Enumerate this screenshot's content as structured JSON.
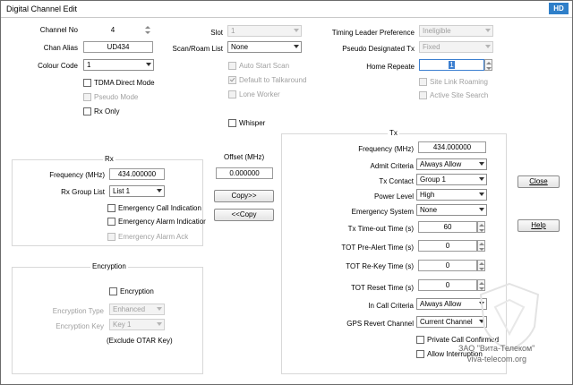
{
  "window": {
    "title": "Digital Channel Edit",
    "badge": "HD"
  },
  "general": {
    "channel_no_label": "Channel No",
    "channel_no_value": "4",
    "chan_alias_label": "Chan Alias",
    "chan_alias_value": "UD434",
    "colour_code_label": "Colour Code",
    "colour_code_value": "1",
    "tdma_direct_label": "TDMA Direct Mode",
    "pseudo_mode_label": "Pseudo Mode",
    "rx_only_label": "Rx Only"
  },
  "slot": {
    "slot_label": "Slot",
    "slot_value": "1",
    "scan_roam_label": "Scan/Roam List",
    "scan_roam_value": "None",
    "auto_start_scan_label": "Auto Start Scan",
    "default_talkaround_label": "Default to Talkaround",
    "lone_worker_label": "Lone Worker",
    "whisper_label": "Whisper"
  },
  "timing": {
    "leader_pref_label": "Timing Leader Preference",
    "leader_pref_value": "Ineligible",
    "pseudo_tx_label": "Pseudo Designated Tx",
    "pseudo_tx_value": "Fixed",
    "home_repeater_label": "Home Repeate",
    "home_repeater_value": "1",
    "site_link_roaming_label": "Site Link Roaming",
    "active_site_search_label": "Active Site Search"
  },
  "rx": {
    "title": "Rx",
    "frequency_label": "Frequency (MHz)",
    "frequency_value": "434.000000",
    "group_list_label": "Rx Group List",
    "group_list_value": "List 1",
    "emergency_call_label": "Emergency Call Indication",
    "emergency_alarm_label": "Emergency Alarm Indicatior",
    "emergency_alarm_ack_label": "Emergency Alarm Ack"
  },
  "offset": {
    "label": "Offset (MHz)",
    "value": "0.000000",
    "copy_to_tx": "Copy>>",
    "copy_to_rx": "<<Copy"
  },
  "encryption": {
    "title": "Encryption",
    "checkbox_label": "Encryption",
    "type_label": "Encryption Type",
    "type_value": "Enhanced",
    "key_label": "Encryption Key",
    "key_value": "Key 1",
    "note": "(Exclude OTAR Key)"
  },
  "tx": {
    "title": "Tx",
    "frequency_label": "Frequency (MHz)",
    "frequency_value": "434.000000",
    "admit_label": "Admit Criteria",
    "admit_value": "Always Allow",
    "contact_label": "Tx Contact",
    "contact_value": "Group 1",
    "power_label": "Power Level",
    "power_value": "High",
    "emergency_system_label": "Emergency System",
    "emergency_system_value": "None",
    "timeout_label": "Tx Time-out Time (s)",
    "timeout_value": "60",
    "prealert_label": "TOT Pre-Alert Time (s)",
    "prealert_value": "0",
    "rekey_label": "TOT Re-Key Time (s)",
    "rekey_value": "0",
    "reset_label": "TOT Reset Time (s)",
    "reset_value": "0",
    "in_call_label": "In Call  Criteria",
    "in_call_value": "Always Allow",
    "gps_revert_label": "GPS Revert Channel",
    "gps_revert_value": "Current Channel",
    "private_call_label": "Private Call Confirmed",
    "allow_interruption_label": "Allow Interruption"
  },
  "buttons": {
    "close": "Close",
    "help": "Help"
  },
  "watermark": {
    "line1": "ЗАО \"Вита-Телеком\"",
    "line2": "viva-telecom.org"
  }
}
